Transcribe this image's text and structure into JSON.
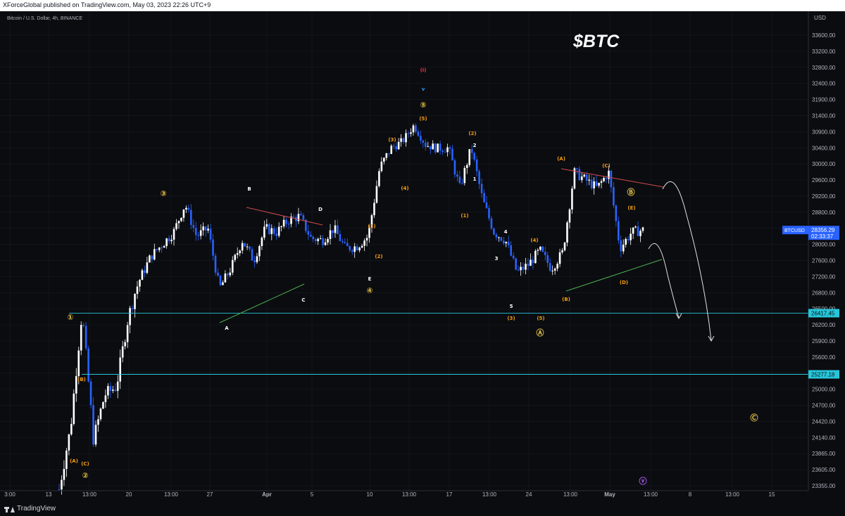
{
  "header": {
    "publisher_line": "XForceGlobal published on TradingView.com, May 03, 2023 22:26 UTC+9"
  },
  "footer": {
    "brand": "TradingView"
  },
  "colors": {
    "background": "#0b0c10",
    "candle_up": "#ffffff",
    "candle_down": "#2962ff",
    "grid": "#1a1d26",
    "wave_orange": "#f39c12",
    "wave_red": "#f23645",
    "wave_blue": "#2196f3",
    "wave_yellow": "#e8c547",
    "wave_purple": "#b45cff",
    "support_line": "#26c6da",
    "trend_red": "#d44b4b",
    "trend_green": "#4caf50",
    "price_badge": "#2962ff"
  },
  "chart_data": {
    "type": "candlestick",
    "symbol_line": "Bitcoin / U.S. Dollar, 4h, BINANCE",
    "title": "$BTC",
    "currency": "USD",
    "y_ticks": [
      "33600.00",
      "33200.00",
      "32800.00",
      "32400.00",
      "31900.00",
      "31400.00",
      "30900.00",
      "30400.00",
      "30000.00",
      "29600.00",
      "29200.00",
      "28800.00",
      "28400.00",
      "28000.00",
      "27600.00",
      "27200.00",
      "26800.00",
      "26500.00",
      "26200.00",
      "25900.00",
      "25600.00",
      "25300.00",
      "25000.00",
      "24700.00",
      "24420.00",
      "24140.00",
      "23865.00",
      "23605.00",
      "23355.00"
    ],
    "x_ticks": [
      "3:00",
      "13",
      "13:00",
      "20",
      "13:00",
      "27",
      "Apr",
      "5",
      "10",
      "13:00",
      "17",
      "13:00",
      "24",
      "13:00",
      "May",
      "13:00",
      "8",
      "13:00",
      "15"
    ],
    "current_price": {
      "symbol": "BTCUSD",
      "value": "28356.29",
      "countdown": "02:33:37"
    },
    "levels": [
      {
        "label": "26417.45",
        "value": 26417.45
      },
      {
        "label": "25277.18",
        "value": 25277.18
      }
    ],
    "close_path_index": [
      23300,
      24300,
      26450,
      24100,
      24900,
      25050,
      26300,
      27100,
      27700,
      28000,
      28300,
      29000,
      28200,
      28400,
      26900,
      27400,
      28100,
      27600,
      28400,
      28300,
      28600,
      28700,
      28150,
      28100,
      28400,
      27900,
      27950,
      28200,
      29900,
      30400,
      30600,
      31100,
      30500,
      30400,
      30400,
      29400,
      30400,
      29100,
      28300,
      28100,
      27300,
      27500,
      27850,
      27400,
      27800,
      29800,
      29600,
      29400,
      29800,
      27900,
      28300,
      28356
    ],
    "labels": [
      {
        "t": "①",
        "c": "wave_yellow"
      },
      {
        "t": "(A)",
        "c": "wave_orange"
      },
      {
        "t": "(B)",
        "c": "wave_orange"
      },
      {
        "t": "(C)",
        "c": "wave_orange"
      },
      {
        "t": "②",
        "c": "wave_yellow"
      },
      {
        "t": "③",
        "c": "wave_yellow"
      },
      {
        "t": "A",
        "c": "white"
      },
      {
        "t": "B",
        "c": "white"
      },
      {
        "t": "C",
        "c": "white"
      },
      {
        "t": "D",
        "c": "white"
      },
      {
        "t": "E",
        "c": "white"
      },
      {
        "t": "④",
        "c": "wave_yellow"
      },
      {
        "t": "(1)",
        "c": "wave_orange"
      },
      {
        "t": "(2)",
        "c": "wave_orange"
      },
      {
        "t": "(3)",
        "c": "wave_orange"
      },
      {
        "t": "(4)",
        "c": "wave_orange"
      },
      {
        "t": "(5)",
        "c": "wave_orange"
      },
      {
        "t": "⑤",
        "c": "wave_yellow"
      },
      {
        "t": "v",
        "c": "wave_blue"
      },
      {
        "t": "(i)",
        "c": "wave_red"
      },
      {
        "t": "(2)",
        "c": "wave_orange"
      },
      {
        "t": "2",
        "c": "white"
      },
      {
        "t": "1",
        "c": "white"
      },
      {
        "t": "(1)",
        "c": "wave_orange"
      },
      {
        "t": "3",
        "c": "white"
      },
      {
        "t": "4",
        "c": "white"
      },
      {
        "t": "5",
        "c": "white"
      },
      {
        "t": "(3)",
        "c": "wave_orange"
      },
      {
        "t": "(4)",
        "c": "wave_orange"
      },
      {
        "t": "(5)",
        "c": "wave_orange"
      },
      {
        "t": "Ⓐ",
        "c": "wave_yellow"
      },
      {
        "t": "(A)",
        "c": "wave_orange"
      },
      {
        "t": "(B)",
        "c": "wave_orange"
      },
      {
        "t": "(C)",
        "c": "wave_orange"
      },
      {
        "t": "(D)",
        "c": "wave_orange"
      },
      {
        "t": "(E)",
        "c": "wave_orange"
      },
      {
        "t": "Ⓑ",
        "c": "wave_yellow"
      },
      {
        "t": "Ⓒ",
        "c": "wave_yellow"
      },
      {
        "t": "ⓥ",
        "c": "wave_purple"
      }
    ]
  }
}
